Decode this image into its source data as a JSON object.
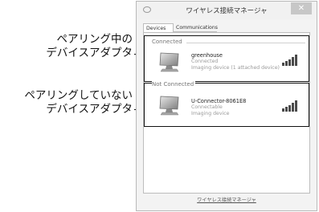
{
  "window": {
    "title": "ワイヤレス接続マネージャ",
    "close_label": "✕"
  },
  "tabs": [
    {
      "label": "Devices"
    },
    {
      "label": "Communications"
    }
  ],
  "groups": {
    "connected": {
      "label": "Connected",
      "device": {
        "name": "greenhouse",
        "status": "Connected",
        "detail": "Imaging device (1 attached device)"
      }
    },
    "not_connected": {
      "label": "Not Connected",
      "device": {
        "name": "U-Connector-8061E8",
        "status": "Connectable",
        "detail": "Imaging device"
      }
    }
  },
  "footer": {
    "link_label": "ワイヤレス接続マネージャ"
  },
  "callouts": {
    "paired": [
      "ペアリング中の",
      "デバイスアダプタ"
    ],
    "unpaired": [
      "ペアリングしていない",
      "デバイスアダプタ"
    ]
  },
  "colors": {
    "callout_frame": "#111111",
    "window_bg": "#f3f3f3",
    "signal_bar": "#4a4a4a"
  },
  "icons": {
    "device": "monitor-icon",
    "signal": "signal-strength-icon",
    "close": "close-icon"
  }
}
